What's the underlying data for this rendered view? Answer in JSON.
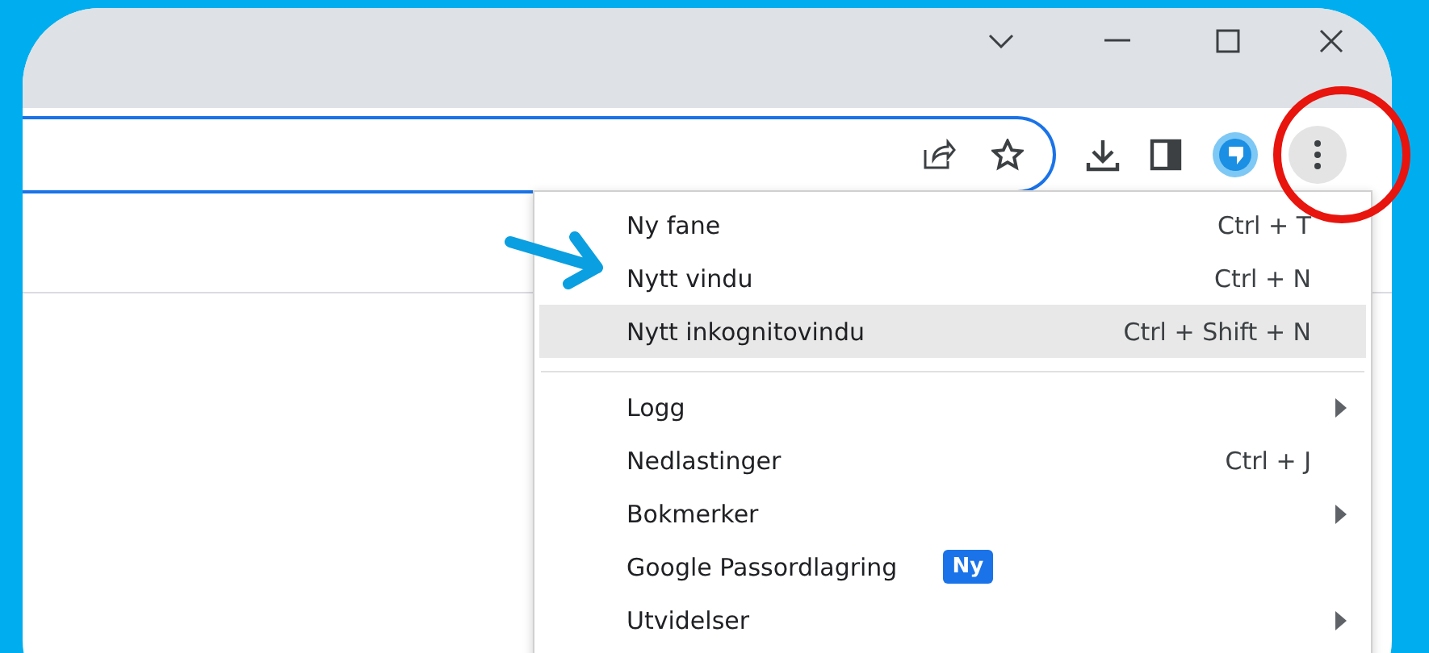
{
  "menu": {
    "groups": [
      {
        "items": [
          {
            "label": "Ny fane",
            "shortcut": "Ctrl + T",
            "submenu": false,
            "selected": false
          },
          {
            "label": "Nytt vindu",
            "shortcut": "Ctrl + N",
            "submenu": false,
            "selected": false
          },
          {
            "label": "Nytt inkognitovindu",
            "shortcut": "Ctrl + Shift + N",
            "submenu": false,
            "selected": true
          }
        ]
      },
      {
        "items": [
          {
            "label": "Logg",
            "submenu": true,
            "selected": false
          },
          {
            "label": "Nedlastinger",
            "shortcut": "Ctrl + J",
            "submenu": false,
            "selected": false
          },
          {
            "label": "Bokmerker",
            "submenu": true,
            "selected": false
          },
          {
            "label": "Google Passordlagring",
            "badge": "Ny",
            "submenu": false,
            "selected": false
          },
          {
            "label": "Utvidelser",
            "submenu": true,
            "selected": false
          }
        ]
      }
    ]
  }
}
